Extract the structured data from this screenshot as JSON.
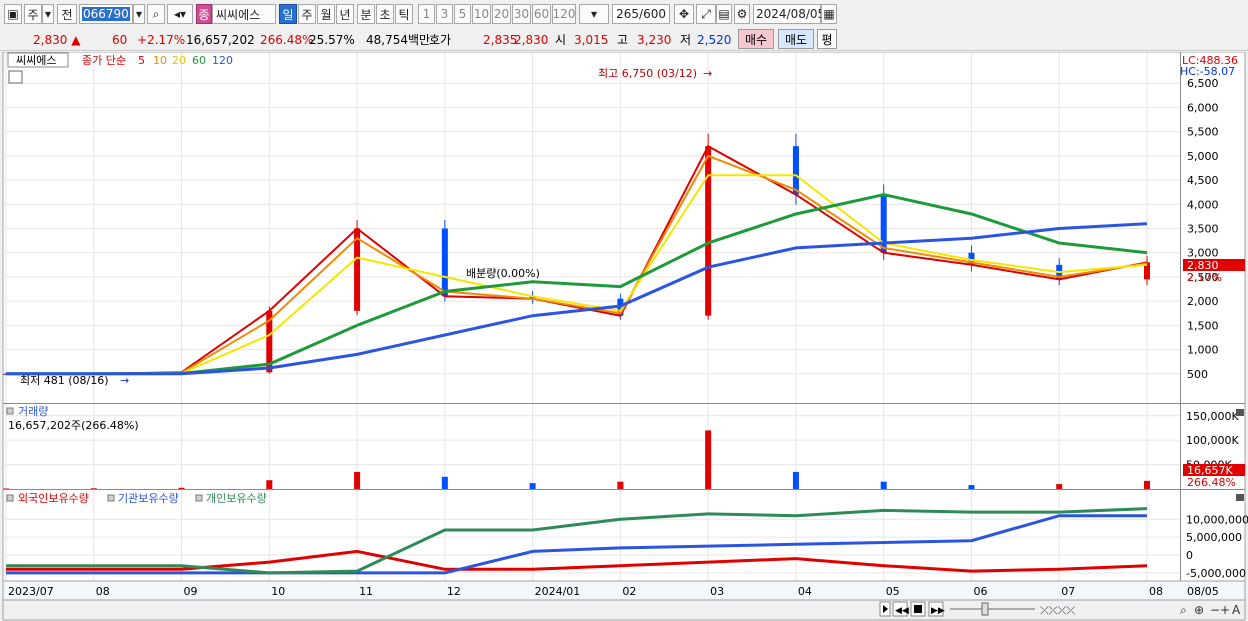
{
  "toolbar": {
    "period_label": "주",
    "jeon_label": "전",
    "code_value": "066790",
    "stock_name": "씨씨에스",
    "jong_label": "종",
    "tabs": [
      "일",
      "주",
      "월",
      "년",
      "분",
      "초",
      "틱"
    ],
    "intervals": [
      "1",
      "3",
      "5",
      "10",
      "20",
      "30",
      "60",
      "120"
    ],
    "count_value": "265",
    "count_total": "/600",
    "date_value": "2024/08/05"
  },
  "quote": {
    "price": "2,830",
    "arrow": "▲",
    "change": "60",
    "change_pct": "+2.17%",
    "volume": "16,657,202",
    "vol_ratio": "266.48%",
    "turnover": "25.57%",
    "amount": "48,754백만",
    "hoga_label": "호가",
    "ask": "2,835",
    "bid": "2,830",
    "open_label": "시",
    "open": "3,015",
    "high_label": "고",
    "high": "3,230",
    "low_label": "저",
    "low": "2,520",
    "buy_label": "매수",
    "sell_label": "매도",
    "eval_label": "평"
  },
  "price_panel": {
    "name": "씨씨에스",
    "ma_label": "종가 단순",
    "ma_periods": [
      "5",
      "10",
      "20",
      "60",
      "120"
    ],
    "lc": "LC:488.36",
    "hc": "HC:-58.07",
    "high_annotation": "최고 6,750 (03/12)",
    "low_annotation": "최저 481 (08/16)",
    "mid_annotation": "배분량(0.00%)",
    "current_tag": "2,830",
    "current_pct": "2.17%"
  },
  "volume_panel": {
    "title": "거래량",
    "value_text": "16,657,202주(266.48%)",
    "current_tag": "16,657K",
    "current_pct": "266.48%",
    "axis_ticks": [
      "150,000K",
      "100,000K",
      "50,000K"
    ]
  },
  "holding_panel": {
    "legends": [
      "외국인보유수량",
      "기관보유수량",
      "개인보유수량"
    ],
    "axis_ticks": [
      "10,000,000",
      "5,000,000",
      "0",
      "-5,000,000"
    ]
  },
  "x_axis": {
    "labels": [
      "2023/07",
      "08",
      "09",
      "10",
      "11",
      "12",
      "2024/01",
      "02",
      "03",
      "04",
      "05",
      "06",
      "07",
      "08"
    ],
    "right_label": "08/05"
  },
  "colors": {
    "up": "#e00000",
    "down": "#0050ff",
    "ma5": "#e00000",
    "ma10": "#f08a00",
    "ma20": "#f5e600",
    "ma60": "#1f9a3a",
    "ma120": "#2b55e0",
    "foreign": "#e00000",
    "institution": "#2b55e0",
    "individual": "#2e8b57"
  },
  "chart_data": [
    {
      "type": "line",
      "title": "씨씨에스",
      "ylim": [
        0,
        7000
      ],
      "yticks": [
        500,
        1000,
        1500,
        2000,
        2500,
        3000,
        3500,
        4000,
        4500,
        5000,
        5500,
        6000,
        6500
      ],
      "months": [
        "2023/07",
        "08",
        "09",
        "10",
        "11",
        "12",
        "2024/01",
        "02",
        "03",
        "04",
        "05",
        "06",
        "07",
        "08"
      ],
      "x": [
        "2023/07",
        "2023/08",
        "2023/09",
        "2023/10",
        "2023/11",
        "2023/12",
        "2024/01",
        "2024/02",
        "2024/03",
        "2024/04",
        "2024/05",
        "2024/06",
        "2024/07",
        "2024/08"
      ],
      "series": [
        {
          "name": "5",
          "values": [
            500,
            500,
            530,
            1800,
            3500,
            2100,
            2050,
            1700,
            5200,
            4200,
            3000,
            2750,
            2450,
            2800
          ]
        },
        {
          "name": "10",
          "values": [
            500,
            500,
            520,
            1600,
            3300,
            2200,
            2050,
            1750,
            5000,
            4300,
            3100,
            2800,
            2500,
            2780
          ]
        },
        {
          "name": "20",
          "values": [
            500,
            500,
            510,
            1300,
            2900,
            2500,
            2100,
            1800,
            4600,
            4600,
            3200,
            2850,
            2600,
            2750
          ]
        },
        {
          "name": "60",
          "values": [
            500,
            500,
            505,
            700,
            1500,
            2200,
            2400,
            2300,
            3200,
            3800,
            4200,
            3800,
            3200,
            3000
          ]
        },
        {
          "name": "120",
          "values": [
            500,
            500,
            500,
            620,
            900,
            1300,
            1700,
            1900,
            2700,
            3100,
            3200,
            3300,
            3500,
            3600
          ]
        }
      ]
    },
    {
      "type": "bar",
      "title": "거래량",
      "ylim": [
        0,
        170000
      ],
      "categories": [
        "2023/07",
        "2023/08",
        "2023/09",
        "2023/10",
        "2023/11",
        "2023/12",
        "2024/01",
        "2024/02",
        "2024/03",
        "2024/04",
        "2024/05",
        "2024/06",
        "2024/07",
        "2024/08"
      ],
      "values": [
        1000,
        1500,
        2500,
        18000,
        35000,
        25000,
        12000,
        15000,
        120000,
        35000,
        15000,
        8000,
        10000,
        16657
      ]
    },
    {
      "type": "line",
      "ylim": [
        -7000000,
        14000000
      ],
      "x": [
        "2023/07",
        "2023/08",
        "2023/09",
        "2023/10",
        "2023/11",
        "2023/12",
        "2024/01",
        "2024/02",
        "2024/03",
        "2024/04",
        "2024/05",
        "2024/06",
        "2024/07",
        "2024/08"
      ],
      "series": [
        {
          "name": "외국인보유수량",
          "values": [
            -4000000,
            -4000000,
            -4000000,
            -2000000,
            1000000,
            -4000000,
            -4000000,
            -3000000,
            -2000000,
            -1000000,
            -3000000,
            -4500000,
            -4000000,
            -3000000
          ]
        },
        {
          "name": "기관보유수량",
          "values": [
            -5000000,
            -5000000,
            -5000000,
            -5000000,
            -5000000,
            -5000000,
            1000000,
            2000000,
            2500000,
            3000000,
            3500000,
            4000000,
            11000000,
            11000000
          ]
        },
        {
          "name": "개인보유수량",
          "values": [
            -3000000,
            -3000000,
            -3000000,
            -5000000,
            -4500000,
            7000000,
            7000000,
            10000000,
            11500000,
            11000000,
            12500000,
            12000000,
            12000000,
            13000000
          ]
        }
      ]
    }
  ]
}
